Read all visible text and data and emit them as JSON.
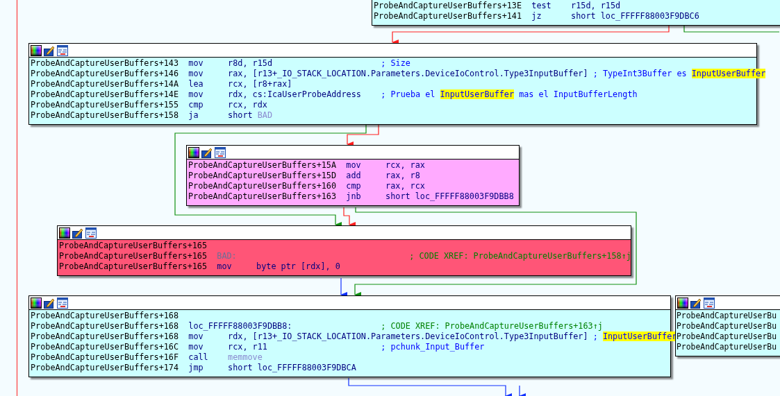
{
  "graph": {
    "nodes": [
      {
        "color": "#ccffff",
        "lines": [
          {
            "address": "ProbeAndCaptureUserBuffers+13E",
            "mnemonic": "test",
            "operands": [
              {
                "text": "r15d, r15d",
                "kind": "plain"
              }
            ]
          },
          {
            "address": "ProbeAndCaptureUserBuffers+141",
            "mnemonic": "jz",
            "operands": [
              {
                "text": "short loc_FFFFF88003F9DBC6",
                "kind": "plain"
              }
            ]
          }
        ]
      },
      {
        "color": "#ccffff",
        "lines": [
          {
            "address": "ProbeAndCaptureUserBuffers+143",
            "mnemonic": "mov",
            "operands": [
              {
                "text": "r8d, r15d",
                "kind": "plain"
              }
            ],
            "comment": {
              "kind": "plain",
              "parts": [
                {
                  "text": "; Size",
                  "highlight": false
                }
              ]
            }
          },
          {
            "address": "ProbeAndCaptureUserBuffers+146",
            "mnemonic": "mov",
            "operands": [
              {
                "text": "rax, [r13+_IO_STACK_LOCATION.Parameters.DeviceIoControl.Type3InputBuffer]",
                "kind": "plain"
              }
            ],
            "comment": {
              "kind": "plain",
              "parts": [
                {
                  "text": "; TypeInt3Buffer es ",
                  "highlight": false
                },
                {
                  "text": "InputUserBuffer",
                  "highlight": true
                }
              ]
            }
          },
          {
            "address": "ProbeAndCaptureUserBuffers+14A",
            "mnemonic": "lea",
            "operands": [
              {
                "text": "rcx, [r8+rax]",
                "kind": "plain"
              }
            ]
          },
          {
            "address": "ProbeAndCaptureUserBuffers+14E",
            "mnemonic": "mov",
            "operands": [
              {
                "text": "rdx, cs:IcaUserProbeAddress",
                "kind": "plain"
              }
            ],
            "comment": {
              "kind": "plain",
              "parts": [
                {
                  "text": "; Prueba el ",
                  "highlight": false
                },
                {
                  "text": "InputUserBuffer",
                  "highlight": true
                },
                {
                  "text": " mas el InputBufferLength",
                  "highlight": false
                }
              ]
            }
          },
          {
            "address": "ProbeAndCaptureUserBuffers+155",
            "mnemonic": "cmp",
            "operands": [
              {
                "text": "rcx, rdx",
                "kind": "plain"
              }
            ]
          },
          {
            "address": "ProbeAndCaptureUserBuffers+158",
            "mnemonic": "ja",
            "operands": [
              {
                "text": "short ",
                "kind": "plain"
              },
              {
                "text": "BAD",
                "kind": "name"
              }
            ]
          }
        ]
      },
      {
        "color": "#ffaaff",
        "lines": [
          {
            "address": "ProbeAndCaptureUserBuffers+15A",
            "mnemonic": "mov",
            "operands": [
              {
                "text": "rcx, rax",
                "kind": "plain"
              }
            ]
          },
          {
            "address": "ProbeAndCaptureUserBuffers+15D",
            "mnemonic": "add",
            "operands": [
              {
                "text": "rax, r8",
                "kind": "plain"
              }
            ]
          },
          {
            "address": "ProbeAndCaptureUserBuffers+160",
            "mnemonic": "cmp",
            "operands": [
              {
                "text": "rax, rcx",
                "kind": "plain"
              }
            ]
          },
          {
            "address": "ProbeAndCaptureUserBuffers+163",
            "mnemonic": "jnb",
            "operands": [
              {
                "text": "short loc_FFFFF88003F9DBB8",
                "kind": "plain"
              }
            ]
          }
        ]
      },
      {
        "color": "#ff5577",
        "lines": [
          {
            "address": "ProbeAndCaptureUserBuffers+165"
          },
          {
            "address": "ProbeAndCaptureUserBuffers+165",
            "label": {
              "text": "BAD:",
              "kind": "name"
            },
            "comment": {
              "kind": "xref",
              "parts": [
                {
                  "text": "; CODE XREF: ProbeAndCaptureUserBuffers+158↑j",
                  "highlight": false
                }
              ]
            }
          },
          {
            "address": "ProbeAndCaptureUserBuffers+165",
            "mnemonic": "mov",
            "operands": [
              {
                "text": "byte ptr [rdx], 0",
                "kind": "plain"
              }
            ]
          }
        ]
      },
      {
        "color": "#ccffff",
        "lines": [
          {
            "address": "ProbeAndCaptureUserBuffers+168"
          },
          {
            "address": "ProbeAndCaptureUserBuffers+168",
            "label": {
              "text": "loc_FFFFF88003F9DBB8:",
              "kind": "plain"
            },
            "comment": {
              "kind": "xref",
              "parts": [
                {
                  "text": "; CODE XREF: ProbeAndCaptureUserBuffers+163↑j",
                  "highlight": false
                }
              ]
            }
          },
          {
            "address": "ProbeAndCaptureUserBuffers+168",
            "mnemonic": "mov",
            "operands": [
              {
                "text": "rdx, [r13+_IO_STACK_LOCATION.Parameters.DeviceIoControl.Type3InputBuffer]",
                "kind": "plain"
              }
            ],
            "comment": {
              "kind": "plain",
              "parts": [
                {
                  "text": "; ",
                  "highlight": false
                },
                {
                  "text": "InputUserBuffer",
                  "highlight": true
                }
              ]
            }
          },
          {
            "address": "ProbeAndCaptureUserBuffers+16C",
            "mnemonic": "mov",
            "operands": [
              {
                "text": "rcx, r11",
                "kind": "plain"
              }
            ],
            "comment": {
              "kind": "plain",
              "parts": [
                {
                  "text": "; pchunk_Input_Buffer",
                  "highlight": false
                }
              ]
            }
          },
          {
            "address": "ProbeAndCaptureUserBuffers+16F",
            "mnemonic": "call",
            "operands": [
              {
                "text": "memmove",
                "kind": "name"
              }
            ]
          },
          {
            "address": "ProbeAndCaptureUserBuffers+174",
            "mnemonic": "jmp",
            "operands": [
              {
                "text": "short loc_FFFFF88003F9DBCA",
                "kind": "plain"
              }
            ]
          }
        ]
      },
      {
        "color": "#ccffff",
        "lines": [
          {
            "address": "ProbeAndCaptureUserBu"
          },
          {
            "address": "ProbeAndCaptureUserBu"
          },
          {
            "address": "ProbeAndCaptureUserBu"
          },
          {
            "address": "ProbeAndCaptureUserBu"
          }
        ]
      }
    ]
  }
}
